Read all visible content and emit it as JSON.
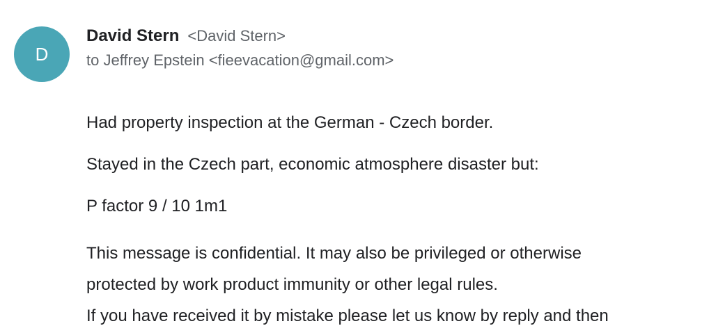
{
  "sender": {
    "avatar_letter": "D",
    "name": "David Stern",
    "email": "<David Stern>"
  },
  "recipient": {
    "line": "to Jeffrey Epstein <fieevacation@gmail.com>"
  },
  "message": {
    "paragraphs": [
      "Had property inspection at the German - Czech border.",
      "Stayed in the Czech part, economic atmosphere disaster but:",
      "P factor 9 / 10 1m1"
    ],
    "disclaimer_lines": [
      "This message is confidential. It may also be privileged or otherwise",
      "protected by work product immunity or other legal rules.",
      "If you have received it by mistake please let us know by reply and then"
    ]
  },
  "colors": {
    "avatar_background": "#4aa6b6",
    "primary_text": "#202124",
    "secondary_text": "#5f6368"
  }
}
